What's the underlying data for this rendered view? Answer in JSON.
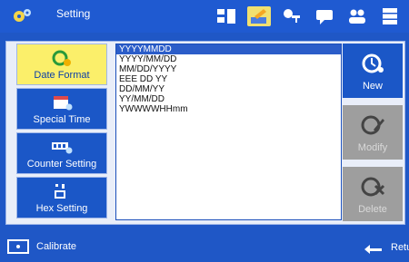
{
  "header": {
    "title": "Setting",
    "icons": [
      "gear-icon",
      "network-icon",
      "edit-settings-icon",
      "key-icon",
      "message-icon",
      "users-icon",
      "database-icon"
    ]
  },
  "sidebar": {
    "items": [
      {
        "label": "Date Format",
        "icon": "date-format-icon",
        "selected": true
      },
      {
        "label": "Special Time",
        "icon": "calendar-icon",
        "selected": false
      },
      {
        "label": "Counter Setting",
        "icon": "counter-icon",
        "selected": false
      },
      {
        "label": "Hex Setting",
        "icon": "hex-icon",
        "selected": false
      }
    ]
  },
  "formats": [
    "YYYYMMDD",
    "YYYY/MM/DD",
    "MM/DD/YYYY",
    "EEE DD YY",
    "DD/MM/YY",
    "YY/MM/DD",
    "YWWWWHHmm"
  ],
  "selected_index": 0,
  "actions": {
    "new_label": "New",
    "modify_label": "Modify",
    "delete_label": "Delete"
  },
  "footer": {
    "calibrate_label": "Calibrate",
    "return_label": "Retu"
  },
  "colors": {
    "primary": "#1f57c6",
    "selected": "#fbef6a",
    "disabled": "#9e9e9e"
  }
}
